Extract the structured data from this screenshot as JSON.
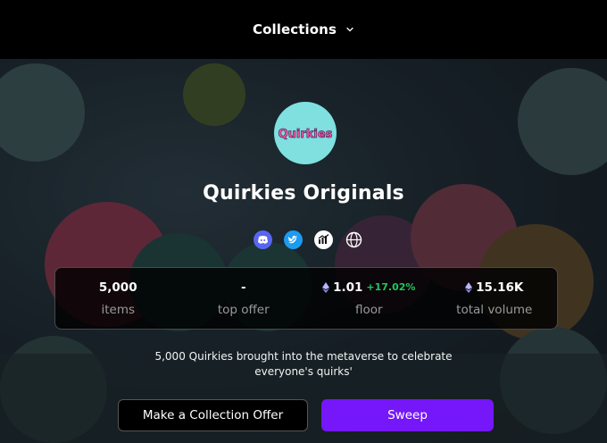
{
  "topbar": {
    "collections_label": "Collections",
    "dropdown_icon": "chevron-down-icon"
  },
  "collection": {
    "logo_text": "Quirkies",
    "name": "Quirkies Originals",
    "socials": [
      {
        "icon": "discord-icon",
        "color": "#5865f2"
      },
      {
        "icon": "twitter-icon",
        "color": "#1d9bf0"
      },
      {
        "icon": "stats-chart-icon",
        "color": "#ffffff"
      },
      {
        "icon": "globe-icon",
        "color": "#ffffff"
      }
    ],
    "description": "5,000 Quirkies brought into the metaverse to celebrate everyone's quirks'"
  },
  "stats": {
    "items": {
      "value": "5,000",
      "label": "items"
    },
    "top_offer": {
      "value": "-",
      "label": "top offer"
    },
    "floor": {
      "value": "1.01",
      "change": "+17.02%",
      "label": "floor"
    },
    "total_volume": {
      "value": "15.16K",
      "label": "total volume"
    }
  },
  "actions": {
    "offer_label": "Make a Collection Offer",
    "sweep_label": "Sweep"
  },
  "colors": {
    "accent": "#7517f8",
    "positive": "#22c55e",
    "avatar_bg": "#7fe0df"
  }
}
